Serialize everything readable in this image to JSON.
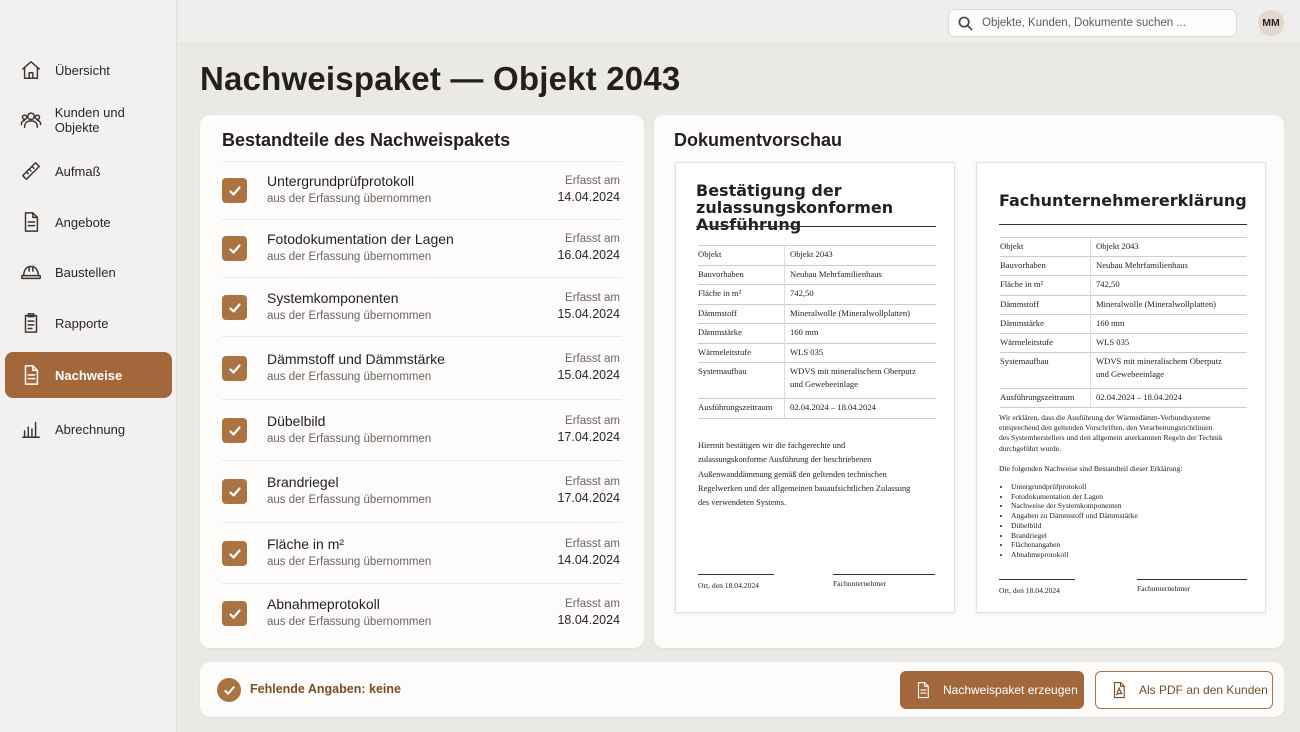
{
  "sidebar": {
    "items": [
      {
        "label": "Übersicht",
        "icon": "home-icon"
      },
      {
        "label": "Kunden und Objekte",
        "icon": "users-icon"
      },
      {
        "label": "Aufmaß",
        "icon": "ruler-icon"
      },
      {
        "label": "Angebote",
        "icon": "document-icon"
      },
      {
        "label": "Baustellen",
        "icon": "hard-hat-icon"
      },
      {
        "label": "Rapporte",
        "icon": "clipboard-icon"
      },
      {
        "label": "Nachweise",
        "icon": "certificate-document-icon",
        "active": true
      },
      {
        "label": "Abrechnung",
        "icon": "bar-chart-icon"
      }
    ]
  },
  "header": {
    "search_placeholder": "Objekte, Kunden, Dokumente suchen ...",
    "avatar_initials": "MM"
  },
  "page": {
    "title": "Nachweispaket — Objekt 2043"
  },
  "components": {
    "title": "Bestandteile des Nachweispakets",
    "items": [
      {
        "name": "Untergrundprüfprotokoll",
        "sub": "aus der Erfassung übernommen",
        "label": "Erfasst am",
        "date": "14.04.2024",
        "checked": true
      },
      {
        "name": "Fotodokumentation der Lagen",
        "sub": "aus der Erfassung übernommen",
        "label": "Erfasst am",
        "date": "16.04.2024",
        "checked": true
      },
      {
        "name": "Systemkomponenten",
        "sub": "aus der Erfassung übernommen",
        "label": "Erfasst am",
        "date": "15.04.2024",
        "checked": true
      },
      {
        "name": "Dämmstoff und Dämmstärke",
        "sub": "aus der Erfassung übernommen",
        "label": "Erfasst am",
        "date": "15.04.2024",
        "checked": true
      },
      {
        "name": "Dübelbild",
        "sub": "aus der Erfassung übernommen",
        "label": "Erfasst am",
        "date": "17.04.2024",
        "checked": true
      },
      {
        "name": "Brandriegel",
        "sub": "aus der Erfassung übernommen",
        "label": "Erfasst am",
        "date": "17.04.2024",
        "checked": true
      },
      {
        "name": "Fläche in m²",
        "sub": "aus der Erfassung übernommen",
        "label": "Erfasst am",
        "date": "14.04.2024",
        "checked": true
      },
      {
        "name": "Abnahmeprotokoll",
        "sub": "aus der Erfassung übernommen",
        "label": "Erfasst am",
        "date": "18.04.2024",
        "checked": true
      }
    ]
  },
  "preview": {
    "title": "Dokumentvorschau",
    "doc1": {
      "title_line1": "Bestätigung der",
      "title_line2": "zulassungskonformen Ausführung",
      "rows": [
        {
          "k": "Objekt",
          "v": "Objekt 2043"
        },
        {
          "k": "Bauvorhaben",
          "v": "Neubau Mehrfamilienhaus"
        },
        {
          "k": "Fläche in m²",
          "v": "742,50"
        },
        {
          "k": "Dämmstoff",
          "v": "Mineralwolle (Mineralwollplatten)"
        },
        {
          "k": "Dämmstärke",
          "v": "160 mm"
        },
        {
          "k": "Wärmeleitstufe",
          "v": "WLS 035"
        },
        {
          "k": "Systemaufbau",
          "v": "WDVS mit mineralischem Oberputz",
          "v2": "und Gewebeeinlage"
        },
        {
          "k": "Ausführungszeitraum",
          "v": "02.04.2024 – 18.04.2024"
        }
      ],
      "paragraph": [
        "Hiermit bestätigen wir die fachgerechte und",
        "zulassungskonforme Ausführung der beschriebenen",
        "Außenwanddämmung gemäß den geltenden technischen",
        "Regelwerken und der allgemeinen bauaufsichtlichen Zulassung",
        "des verwendeten Systems."
      ],
      "sig_left": "Ort, den 18.04.2024",
      "sig_right": "Fachunternehmer"
    },
    "doc2": {
      "title": "Fachunternehmererklärung",
      "rows": [
        {
          "k": "Objekt",
          "v": "Objekt 2043"
        },
        {
          "k": "Bauvorhaben",
          "v": "Neubau Mehrfamilienhaus"
        },
        {
          "k": "Fläche in m²",
          "v": "742,50"
        },
        {
          "k": "Dämmstoff",
          "v": "Mineralwolle (Mineralwollplatten)"
        },
        {
          "k": "Dämmstärke",
          "v": "160 mm"
        },
        {
          "k": "Wärmeleitstufe",
          "v": "WLS 035"
        },
        {
          "k": "Systemaufbau",
          "v": "WDVS mit mineralischem Oberputz",
          "v2": "und Gewebeeinlage"
        },
        {
          "k": "Ausführungszeitraum",
          "v": "02.04.2024 – 18.04.2024"
        }
      ],
      "declaration": [
        "Wir erklären, dass die Ausführung der Wärmedämm-Verbundsysteme",
        "entsprechend den geltenden Vorschriften, den Verarbeitungsrichtlinien",
        "des Systemherstellers und den allgemein anerkannten Regeln der Technik",
        "durchgeführt wurde."
      ],
      "list_intro": "Die folgenden Nachweise sind Bestandteil dieser Erklärung:",
      "list": [
        "Untergrundprüfprotokoll",
        "Fotodokumentation der Lagen",
        "Nachweise der Systemkomponenten",
        "Angaben zu Dämmstoff und Dämmstärke",
        "Dübelbild",
        "Brandriegel",
        "Flächenangaben",
        "Abnahmeprotokoll"
      ],
      "sig_left": "Ort, den 18.04.2024",
      "sig_right": "Fachunternehmer"
    }
  },
  "footer": {
    "status": "Fehlende Angaben: keine",
    "primary_button": "Nachweispaket erzeugen",
    "secondary_button": "Als PDF an den Kunden"
  },
  "colors": {
    "accent": "#a2683b",
    "check": "#a97442",
    "background": "#ebe9e6"
  }
}
